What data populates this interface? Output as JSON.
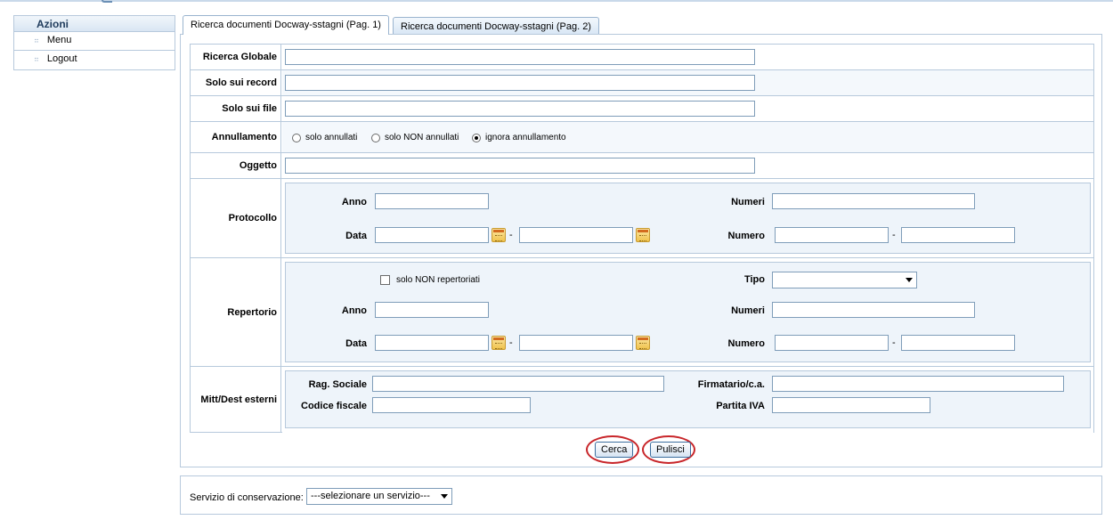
{
  "sidebar": {
    "title": "Azioni",
    "items": [
      {
        "label": "Menu"
      },
      {
        "label": "Logout"
      }
    ]
  },
  "tabs": [
    {
      "label": "Ricerca documenti Docway-sstagni (Pag. 1)",
      "active": true
    },
    {
      "label": "Ricerca documenti Docway-sstagni (Pag. 2)",
      "active": false
    }
  ],
  "form": {
    "ricerca_globale": {
      "label": "Ricerca Globale",
      "value": ""
    },
    "solo_record": {
      "label": "Solo sui record",
      "value": ""
    },
    "solo_file": {
      "label": "Solo sui file",
      "value": ""
    },
    "annullamento": {
      "label": "Annullamento",
      "options": [
        {
          "label": "solo annullati",
          "checked": false
        },
        {
          "label": "solo NON annullati",
          "checked": false
        },
        {
          "label": "ignora annullamento",
          "checked": true
        }
      ]
    },
    "oggetto": {
      "label": "Oggetto",
      "value": ""
    },
    "protocollo": {
      "label": "Protocollo",
      "anno_label": "Anno",
      "data_label": "Data",
      "numeri_label": "Numeri",
      "numero_label": "Numero",
      "dash": "-"
    },
    "repertorio": {
      "label": "Repertorio",
      "checkbox_label": "solo NON repertoriati",
      "tipo_label": "Tipo",
      "tipo_value": "",
      "anno_label": "Anno",
      "numeri_label": "Numeri",
      "data_label": "Data",
      "numero_label": "Numero",
      "dash": "-"
    },
    "mitt_dest": {
      "label": "Mitt/Dest esterni",
      "rag_sociale_label": "Rag. Sociale",
      "firmatario_label": "Firmatario/c.a.",
      "codice_fiscale_label": "Codice fiscale",
      "partita_iva_label": "Partita IVA"
    }
  },
  "buttons": {
    "cerca": "Cerca",
    "pulisci": "Pulisci"
  },
  "servizio": {
    "label": "Servizio di conservazione:",
    "selected": "---selezionare un servizio---"
  },
  "colors": {
    "border": "#b7c9dc",
    "panel_bg": "#eef4fa",
    "highlight_ring": "#c8262a"
  }
}
